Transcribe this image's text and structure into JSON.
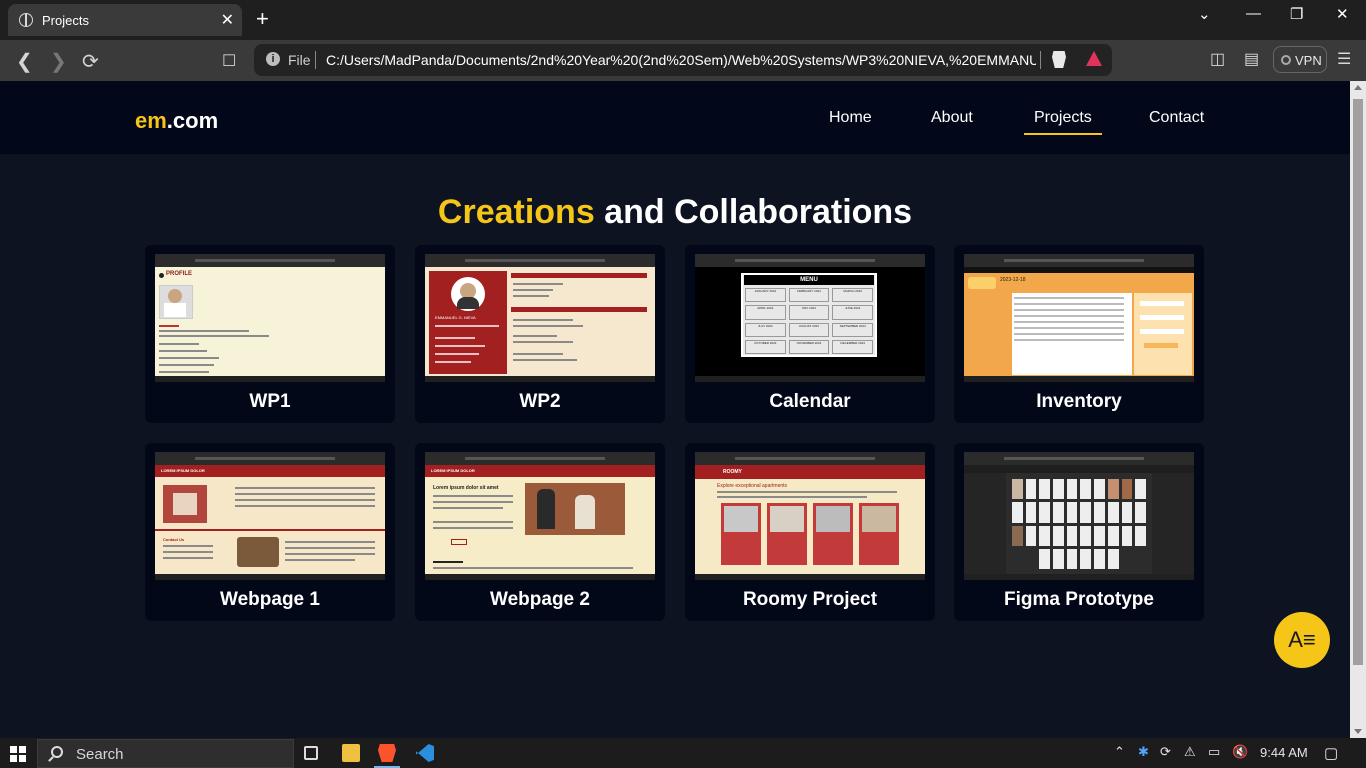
{
  "browser": {
    "tab_title": "Projects",
    "tab_close": "✕",
    "new_tab": "+",
    "address_scheme": "File",
    "address_url": "C:/Users/MadPanda/Documents/2nd%20Year%20(2nd%20Sem)/Web%20Systems/WP3%20NIEVA,%20EMMANU...",
    "vpn_label": "VPN"
  },
  "site": {
    "logo_accent": "em",
    "logo_rest": ".com",
    "nav": [
      {
        "label": "Home"
      },
      {
        "label": "About"
      },
      {
        "label": "Projects"
      },
      {
        "label": "Contact"
      }
    ],
    "heading_accent": "Creations",
    "heading_rest": " and Collaborations",
    "projects": [
      {
        "title": "WP1"
      },
      {
        "title": "WP2"
      },
      {
        "title": "Calendar"
      },
      {
        "title": "Inventory"
      },
      {
        "title": "Webpage 1"
      },
      {
        "title": "Webpage 2"
      },
      {
        "title": "Roomy Project"
      },
      {
        "title": "Figma Prototype"
      }
    ],
    "thumb_text": {
      "wp1_profile": "PROFILE",
      "wp2_name": "EMMANUEL G. NIEVA",
      "calendar_menu": "MENU",
      "calendar_months": [
        "JANUARY 2024",
        "FEBRUARY 2024",
        "MARCH 2024",
        "APRIL 2024",
        "MAY 2024",
        "JUNE 2024",
        "JULY 2024",
        "AUGUST 2024",
        "SEPTEMBER 2024",
        "OCTOBER 2024",
        "NOVEMBER 2024",
        "DECEMBER 2024"
      ],
      "inventory_date": "2023-12-18",
      "lorem_header": "LOREM IPSUM DOLOR",
      "contact_us": "Contact Us",
      "lorem_title": "Lorem ipsum dolor sit amet",
      "roomy_brand": "ROOMY",
      "roomy_tagline": "Explore exceptional apartments"
    },
    "accent_color": "#f5c518"
  },
  "taskbar": {
    "search_label": "Search",
    "time": "9:44 AM"
  }
}
